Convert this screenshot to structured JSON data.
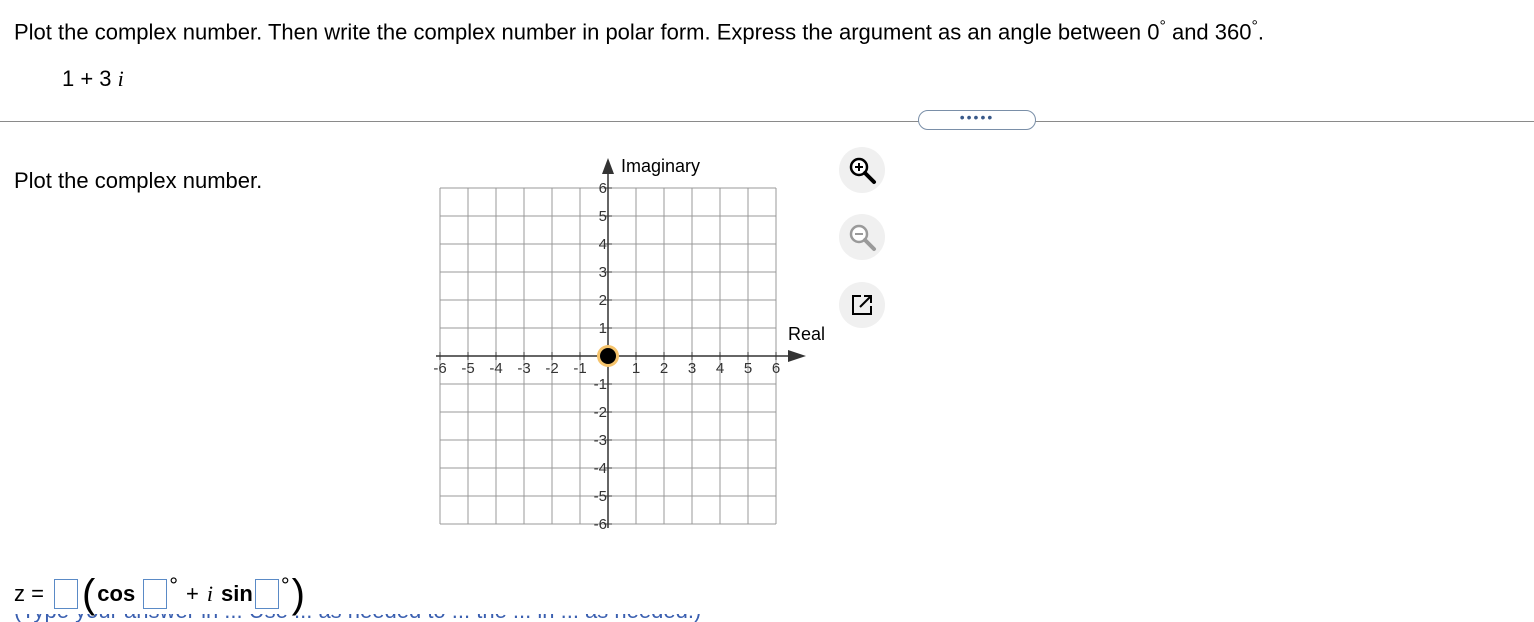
{
  "question": {
    "text_before": "Plot the complex number.  Then write the complex number in polar form.  Express the argument as an angle between 0",
    "deg1": "°",
    "text_mid": " and 360",
    "deg2": "°",
    "text_end": ".",
    "expr_real": "1 + 3",
    "expr_imag": "i"
  },
  "more_button": "•••••",
  "part_label": "Plot the complex number.",
  "graph": {
    "x_label": "Real",
    "y_label": "Imaginary",
    "x_range": [
      -6,
      6
    ],
    "y_range": [
      -6,
      6
    ],
    "x_ticks": [
      "-6",
      "-5",
      "-4",
      "-3",
      "-2",
      "-1",
      "1",
      "2",
      "3",
      "4",
      "5",
      "6"
    ],
    "y_ticks": [
      "6",
      "5",
      "4",
      "3",
      "2",
      "1",
      "-1",
      "-2",
      "-3",
      "-4",
      "-5",
      "-6"
    ],
    "point": {
      "x": 0,
      "y": 0
    },
    "point_fill": "#000000",
    "point_ring": "#f5c36b",
    "grid_color": "#999999"
  },
  "tools": [
    "zoom-in-icon",
    "zoom-out-icon",
    "expand-icon"
  ],
  "answer": {
    "z_label": "z =",
    "cos_label": "cos",
    "deg_symbol": "°",
    "plus": "+",
    "i": "i",
    "sin_label": "sin",
    "open_paren": "(",
    "close_paren": ")"
  },
  "cutoff_text": "(Type your answer in ... Use ... as needed to ... the ... in ... as needed.)"
}
